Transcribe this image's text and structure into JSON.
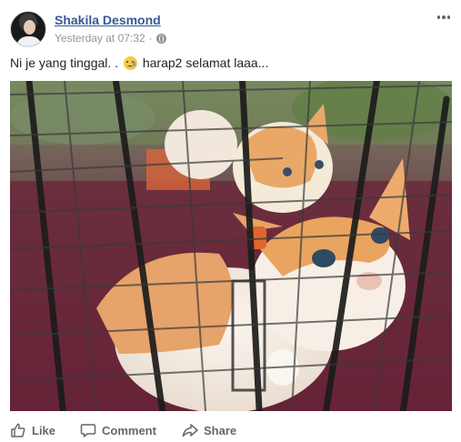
{
  "post": {
    "author": "Shakila Desmond",
    "timestamp": "Yesterday at 07:32",
    "separator": "·",
    "privacy_icon": "globe-icon",
    "message_before_emoji": "Ni je yang tinggal. . ",
    "emoji": "crying-face-emoji",
    "message_after_emoji": " harap2 selamat laaa...",
    "photo_subject": "kittens-in-cage-photo"
  },
  "actions": {
    "like_label": "Like",
    "comment_label": "Comment",
    "share_label": "Share"
  },
  "colors": {
    "author_link": "#365899",
    "meta_text": "#90949c",
    "action_text": "#606770",
    "body_text": "#1d2129"
  }
}
